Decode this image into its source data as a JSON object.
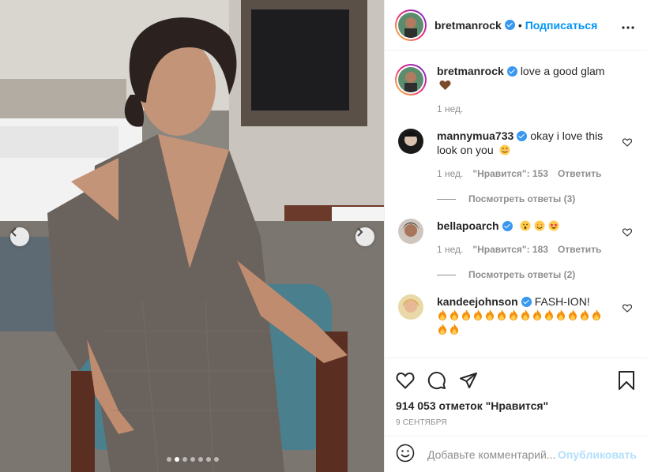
{
  "post": {
    "username": "bretmanrock",
    "separator": "•",
    "follow_label": "Подписаться",
    "more_icon": "more-horizontal-icon",
    "caption": {
      "username": "bretmanrock",
      "text": "love a good glam",
      "emoji": "brown-heart",
      "time": "1 нед."
    },
    "comments": [
      {
        "username": "mannymua733",
        "text": "okay i love this look on you",
        "emoji": "smiling-face",
        "time": "1 нед.",
        "likes": "\"Нравится\": 153",
        "reply": "Ответить",
        "view_replies": "Посмотреть ответы (3)"
      },
      {
        "username": "bellapoarch",
        "text": "",
        "emoji": "astonished, heart-eyes, star-struck",
        "time": "1 нед.",
        "likes": "\"Нравится\": 183",
        "reply": "Ответить",
        "view_replies": "Посмотреть ответы (2)"
      },
      {
        "username": "kandeejohnson",
        "text": "FASH-ION!",
        "emoji": "fire x15"
      }
    ],
    "likes_count": "914 053 отметок \"Нравится\"",
    "date": "9 СЕНТЯБРЯ",
    "comment_placeholder": "Добавьте комментарий...",
    "publish_label": "Опубликовать",
    "carousel": {
      "slides": 7,
      "active": 2
    },
    "colors": {
      "accent": "#0095f6",
      "verified": "#3897f0",
      "muted": "#8e8e8e",
      "publish_disabled": "#b2dffc"
    }
  }
}
